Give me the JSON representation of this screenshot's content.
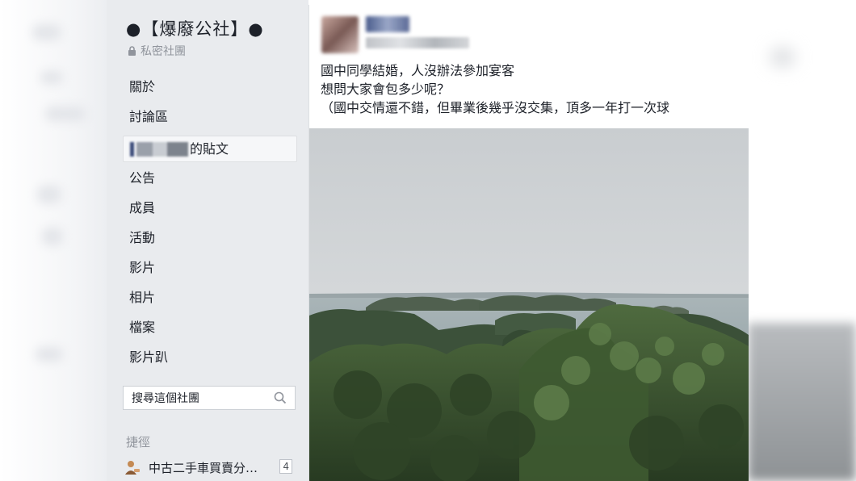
{
  "sidebar": {
    "group_name": "●【爆廢公社】●",
    "privacy": "私密社團",
    "nav": [
      {
        "label": "關於"
      },
      {
        "label": "討論區"
      },
      {
        "label": "的貼文"
      },
      {
        "label": "公告"
      },
      {
        "label": "成員"
      },
      {
        "label": "活動"
      },
      {
        "label": "影片"
      },
      {
        "label": "相片"
      },
      {
        "label": "檔案"
      },
      {
        "label": "影片趴"
      }
    ],
    "search_placeholder": "搜尋這個社團",
    "shortcuts_heading": "捷徑",
    "shortcut": {
      "label": "中古二手車買賣分…",
      "count": "4"
    }
  },
  "post": {
    "line1": "國中同學結婚，人沒辦法參加宴客",
    "line2": "想問大家會包多少呢？",
    "line3": "（國中交情還不錯，但畢業後幾乎沒交集，頂多一年打一次球",
    "photo_icon": "landscape-photo"
  },
  "colors": {
    "sidebar_bg": "#e9ebee",
    "text": "#1d2129",
    "muted": "#90949c",
    "active_bg": "#f6f7f9"
  }
}
